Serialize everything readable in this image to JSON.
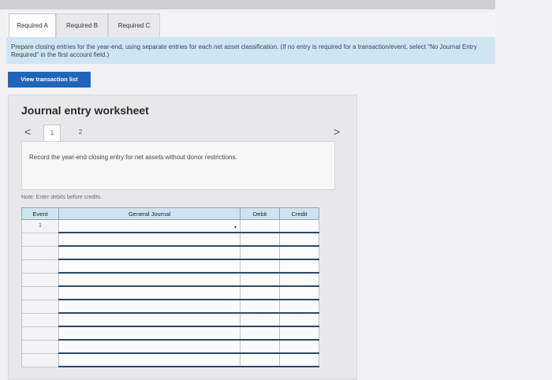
{
  "tabs": [
    "Required A",
    "Required B",
    "Required C"
  ],
  "active_tab": "Required A",
  "instructions": "Prepare closing entries for the year-end, using separate entries for each net asset classification. (If no entry is required for a transaction/event, select \"No Journal Entry Required\" in the first account field.)",
  "view_button": "View transaction list",
  "worksheet": {
    "title": "Journal entry worksheet",
    "prev_arrow": "<",
    "next_arrow": ">",
    "pages": [
      "1",
      "2"
    ],
    "active_page": "1",
    "record_text": "Record the year-end closing entry for net assets without donor restrictions.",
    "note": "Note: Enter debits before credits.",
    "table": {
      "headers": [
        "Event",
        "General Journal",
        "Debit",
        "Credit"
      ],
      "event_label": "1",
      "row_count": 11
    }
  }
}
